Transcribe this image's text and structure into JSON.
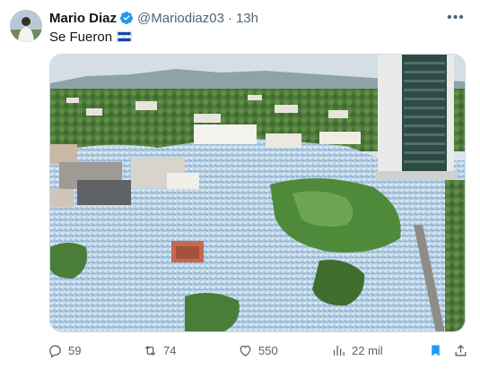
{
  "author": {
    "name": "Mario Diaz",
    "handle": "@Mariodiaz03",
    "separator": "·",
    "time": "13h"
  },
  "tweet": {
    "text": "Se Fueron"
  },
  "stats": {
    "replies": "59",
    "retweets": "74",
    "likes": "550",
    "views": "22 mil"
  },
  "colors": {
    "verified": "#1d9bf0",
    "bookmark_active": "#1d9bf0",
    "muted_text": "#536471",
    "flag_blue": "#0f47af"
  },
  "icons": {
    "more": "more-options-icon",
    "verified": "verified-badge-icon",
    "reply": "reply-icon",
    "retweet": "retweet-icon",
    "like": "heart-icon",
    "views": "views-chart-icon",
    "bookmark": "bookmark-icon",
    "share": "share-icon"
  }
}
